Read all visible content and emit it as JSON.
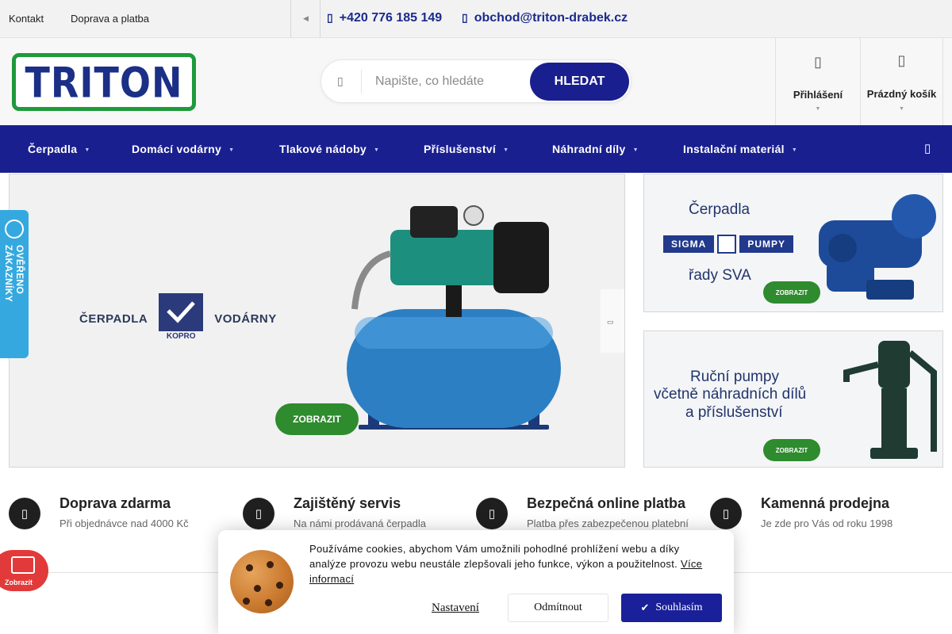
{
  "topbar": {
    "links": [
      "Kontakt",
      "Doprava a platba"
    ],
    "phone": "+420 776 185 149",
    "email": "obchod@triton-drabek.cz",
    "more_icon": "chevron-icon"
  },
  "header": {
    "logo_text": "TRITON",
    "search_placeholder": "Napište, co hledáte",
    "search_button": "HLEDAT",
    "login_label": "Přihlášení",
    "cart_label": "Prázdný košík"
  },
  "nav": {
    "items": [
      "Čerpadla",
      "Domácí vodárny",
      "Tlakové nádoby",
      "Příslušenství",
      "Náhradní díly",
      "Instalační materiál"
    ]
  },
  "hero": {
    "left_word": "ČERPADLA",
    "right_word": "VODÁRNY",
    "brand": "KOPRO",
    "button": "ZOBRAZIT"
  },
  "banners": [
    {
      "title_top": "Čerpadla",
      "brand_left": "SIGMA",
      "brand_right": "PUMPY",
      "title_bottom": "řady SVA",
      "button": "ZOBRAZIT"
    },
    {
      "line1": "Ruční pumpy",
      "line2": "včetně náhradních dílů",
      "line3": "a příslušenství",
      "button": "ZOBRAZIT"
    }
  ],
  "benefits": [
    {
      "title": "Doprava zdarma",
      "text": "Při objednávce nad 4000 Kč",
      "icon": "truck-icon"
    },
    {
      "title": "Zajištěný servis",
      "text": "Na námi prodávaná čerpadla",
      "icon": "thumbs-up-icon"
    },
    {
      "title": "Bezpečná online platba",
      "text": "Platba přes zabezpečenou platební",
      "icon": "card-icon"
    },
    {
      "title": "Kamenná prodejna",
      "text": "Je zde pro Vás od roku 1998",
      "icon": "store-icon"
    }
  ],
  "side": {
    "verified_label": "OVĚŘENO ZÁKAZNÍKY",
    "show_label": "Zobrazit"
  },
  "cookie": {
    "message": "Používáme cookies, abychom Vám umožnili pohodlné prohlížení webu a díky analýze provozu webu neustále zlepšovali jeho funkce, výkon a použitelnost.",
    "more": "Více informací",
    "settings": "Nastavení",
    "decline": "Odmítnout",
    "accept": "Souhlasím"
  },
  "colors": {
    "brand_blue": "#1a1f8f",
    "green": "#2e8b2e",
    "verified_blue": "#35a9df",
    "red": "#e23a3a"
  }
}
